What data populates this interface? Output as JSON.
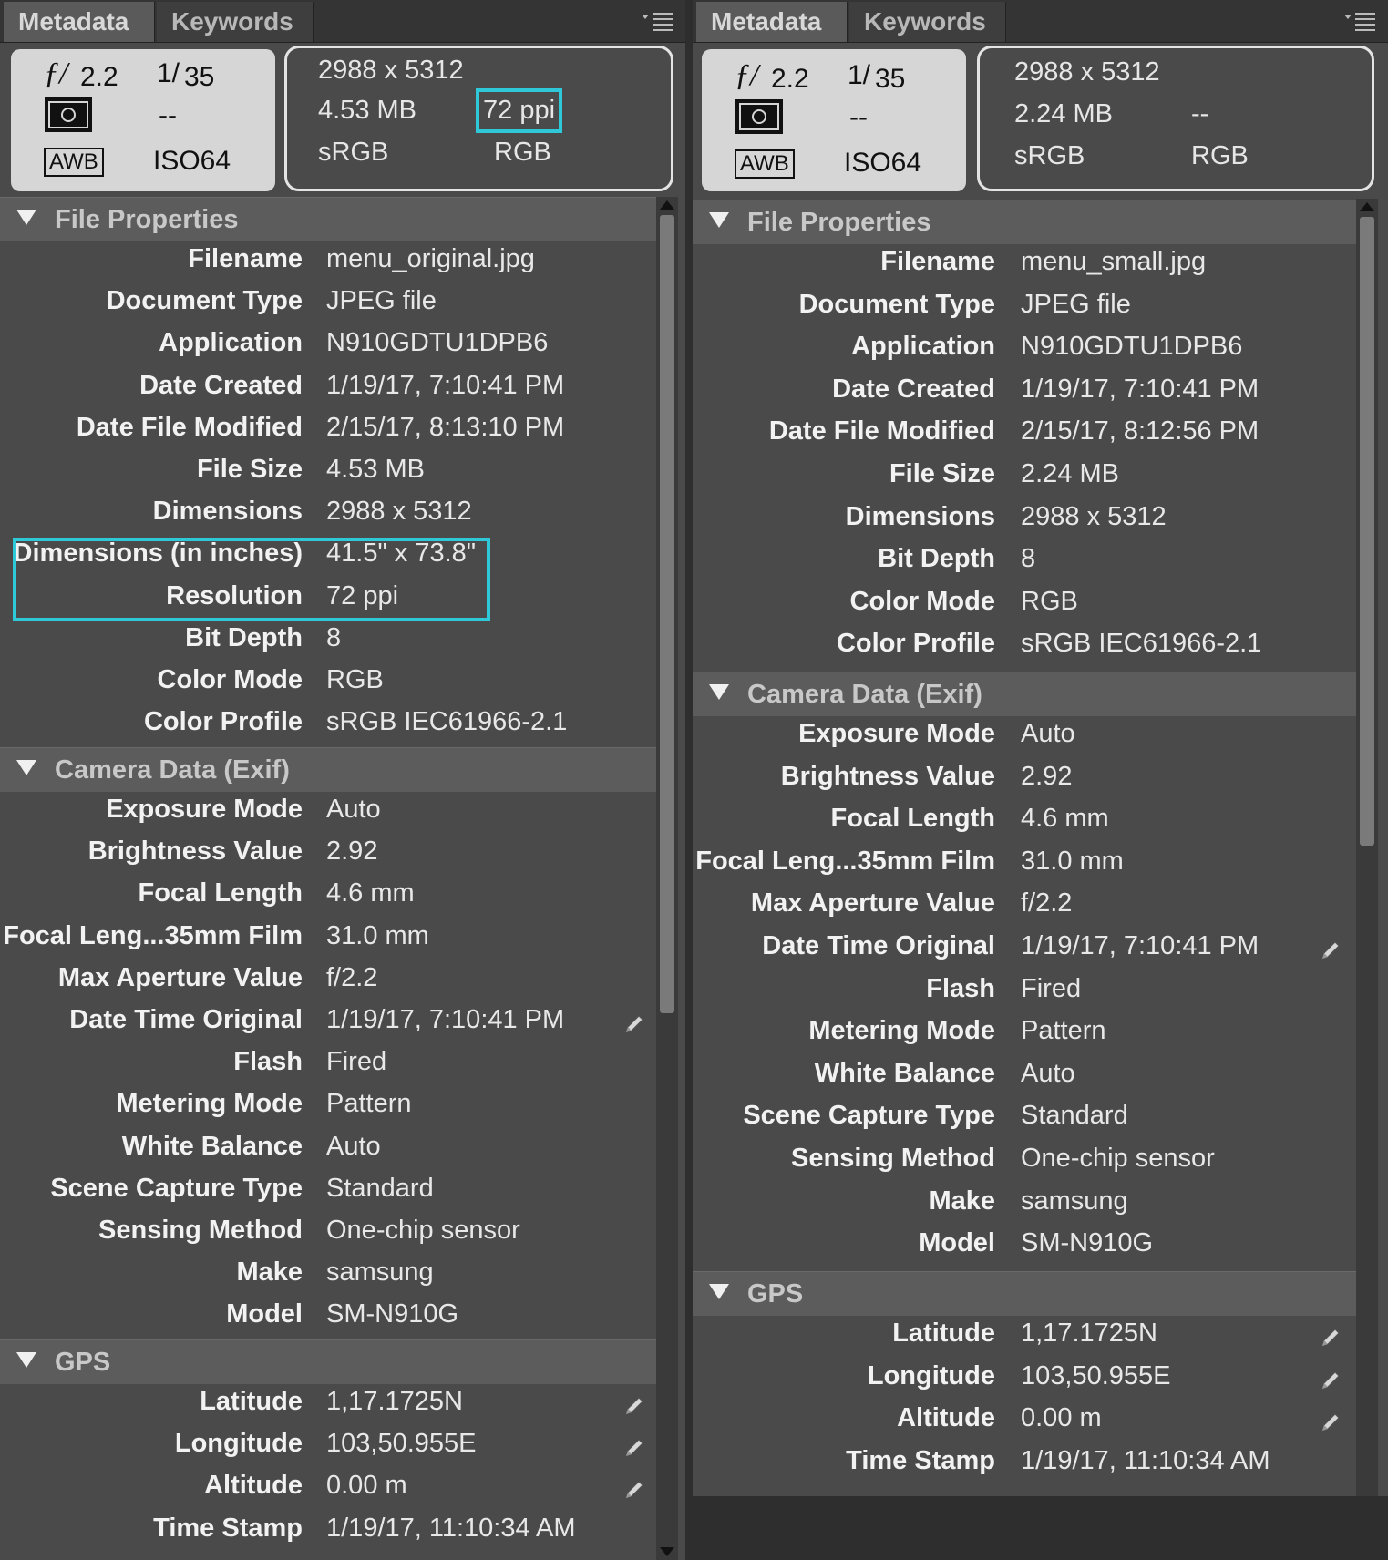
{
  "colors": {
    "highlight": "#2ec8d8",
    "panel_bg": "#4a4a4a",
    "header_bg": "#5c5c5c"
  },
  "left": {
    "tabs": [
      "Metadata",
      "Keywords"
    ],
    "summary": {
      "aperture": "2.2",
      "shutter_num": "1/",
      "shutter_den": "35",
      "metering_icon": "metering-pattern-icon",
      "flash": "--",
      "wb": "AWB",
      "iso": "ISO64",
      "dimensions": "2988 x 5312",
      "file_size": "4.53 MB",
      "resolution": "72 ppi",
      "color_profile": "sRGB",
      "color_mode": "RGB"
    },
    "sections": {
      "file_properties": {
        "title": "File Properties",
        "rows": [
          {
            "label": "Filename",
            "value": "menu_original.jpg"
          },
          {
            "label": "Document Type",
            "value": "JPEG file"
          },
          {
            "label": "Application",
            "value": "N910GDTU1DPB6"
          },
          {
            "label": "Date Created",
            "value": "1/19/17, 7:10:41 PM"
          },
          {
            "label": "Date File Modified",
            "value": "2/15/17, 8:13:10 PM"
          },
          {
            "label": "File Size",
            "value": "4.53 MB"
          },
          {
            "label": "Dimensions",
            "value": "2988 x 5312"
          },
          {
            "label": "Dimensions (in inches)",
            "value": "41.5\" x 73.8\""
          },
          {
            "label": "Resolution",
            "value": "72 ppi"
          },
          {
            "label": "Bit Depth",
            "value": "8"
          },
          {
            "label": "Color Mode",
            "value": "RGB"
          },
          {
            "label": "Color Profile",
            "value": "sRGB IEC61966-2.1"
          }
        ]
      },
      "camera_data": {
        "title": "Camera Data (Exif)",
        "rows": [
          {
            "label": "Exposure Mode",
            "value": "Auto"
          },
          {
            "label": "Brightness Value",
            "value": "2.92"
          },
          {
            "label": "Focal Length",
            "value": "4.6 mm"
          },
          {
            "label": "Focal Leng...35mm Film",
            "value": "31.0 mm"
          },
          {
            "label": "Max Aperture Value",
            "value": "f/2.2"
          },
          {
            "label": "Date Time Original",
            "value": "1/19/17, 7:10:41 PM"
          },
          {
            "label": "Flash",
            "value": "Fired"
          },
          {
            "label": "Metering Mode",
            "value": "Pattern"
          },
          {
            "label": "White Balance",
            "value": "Auto"
          },
          {
            "label": "Scene Capture Type",
            "value": "Standard"
          },
          {
            "label": "Sensing Method",
            "value": "One-chip sensor"
          },
          {
            "label": "Make",
            "value": "samsung"
          },
          {
            "label": "Model",
            "value": "SM-N910G"
          }
        ]
      },
      "gps": {
        "title": "GPS",
        "rows": [
          {
            "label": "Latitude",
            "value": "1,17.1725N"
          },
          {
            "label": "Longitude",
            "value": "103,50.955E"
          },
          {
            "label": "Altitude",
            "value": "0.00 m"
          },
          {
            "label": "Time Stamp",
            "value": "1/19/17, 11:10:34 AM"
          }
        ]
      }
    }
  },
  "right": {
    "tabs": [
      "Metadata",
      "Keywords"
    ],
    "summary": {
      "aperture": "2.2",
      "shutter_num": "1/",
      "shutter_den": "35",
      "metering_icon": "metering-pattern-icon",
      "flash": "--",
      "wb": "AWB",
      "iso": "ISO64",
      "dimensions": "2988 x 5312",
      "file_size": "2.24 MB",
      "resolution": "--",
      "color_profile": "sRGB",
      "color_mode": "RGB"
    },
    "sections": {
      "file_properties": {
        "title": "File Properties",
        "rows": [
          {
            "label": "Filename",
            "value": "menu_small.jpg"
          },
          {
            "label": "Document Type",
            "value": "JPEG file"
          },
          {
            "label": "Application",
            "value": "N910GDTU1DPB6"
          },
          {
            "label": "Date Created",
            "value": "1/19/17, 7:10:41 PM"
          },
          {
            "label": "Date File Modified",
            "value": "2/15/17, 8:12:56 PM"
          },
          {
            "label": "File Size",
            "value": "2.24 MB"
          },
          {
            "label": "Dimensions",
            "value": "2988 x 5312"
          },
          {
            "label": "Bit Depth",
            "value": "8"
          },
          {
            "label": "Color Mode",
            "value": "RGB"
          },
          {
            "label": "Color Profile",
            "value": "sRGB IEC61966-2.1"
          }
        ]
      },
      "camera_data": {
        "title": "Camera Data (Exif)",
        "rows": [
          {
            "label": "Exposure Mode",
            "value": "Auto"
          },
          {
            "label": "Brightness Value",
            "value": "2.92"
          },
          {
            "label": "Focal Length",
            "value": "4.6 mm"
          },
          {
            "label": "Focal Leng...35mm Film",
            "value": "31.0 mm"
          },
          {
            "label": "Max Aperture Value",
            "value": "f/2.2"
          },
          {
            "label": "Date Time Original",
            "value": "1/19/17, 7:10:41 PM"
          },
          {
            "label": "Flash",
            "value": "Fired"
          },
          {
            "label": "Metering Mode",
            "value": "Pattern"
          },
          {
            "label": "White Balance",
            "value": "Auto"
          },
          {
            "label": "Scene Capture Type",
            "value": "Standard"
          },
          {
            "label": "Sensing Method",
            "value": "One-chip sensor"
          },
          {
            "label": "Make",
            "value": "samsung"
          },
          {
            "label": "Model",
            "value": "SM-N910G"
          }
        ]
      },
      "gps": {
        "title": "GPS",
        "rows": [
          {
            "label": "Latitude",
            "value": "1,17.1725N"
          },
          {
            "label": "Longitude",
            "value": "103,50.955E"
          },
          {
            "label": "Altitude",
            "value": "0.00 m"
          },
          {
            "label": "Time Stamp",
            "value": "1/19/17, 11:10:34 AM"
          }
        ]
      }
    }
  }
}
